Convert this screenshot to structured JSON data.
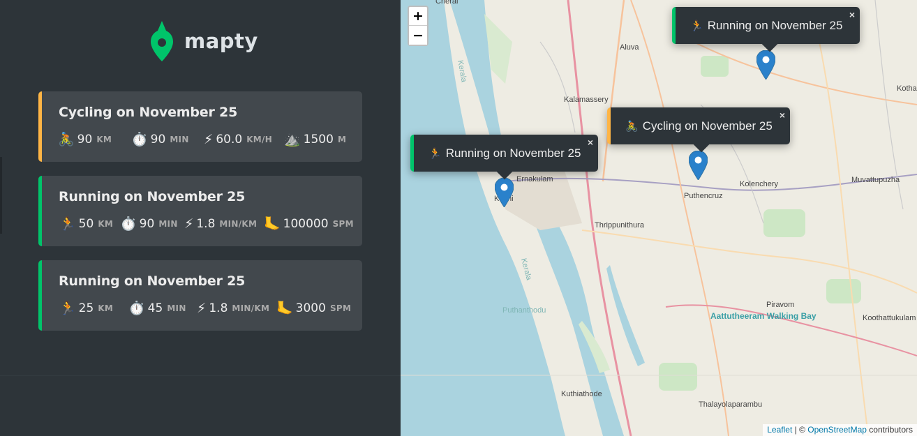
{
  "app": {
    "name": "mapty"
  },
  "workouts": [
    {
      "type": "cycling",
      "title": "Cycling on November 25",
      "icons": {
        "activity": "cycling-icon",
        "time": "stopwatch-icon",
        "speed": "lightning-icon",
        "elevation": "mountain-icon"
      },
      "distance": {
        "value": "90",
        "unit": "km"
      },
      "duration": {
        "value": "90",
        "unit": "min"
      },
      "speed": {
        "value": "60.0",
        "unit": "km/h"
      },
      "elevation": {
        "value": "1500",
        "unit": "m"
      }
    },
    {
      "type": "running",
      "title": "Running on November 25",
      "icons": {
        "activity": "running-icon",
        "time": "stopwatch-icon",
        "pace": "lightning-icon",
        "cadence": "foot-icon"
      },
      "distance": {
        "value": "50",
        "unit": "km"
      },
      "duration": {
        "value": "90",
        "unit": "min"
      },
      "pace": {
        "value": "1.8",
        "unit": "min/km"
      },
      "cadence": {
        "value": "100000",
        "unit": "spm"
      }
    },
    {
      "type": "running",
      "title": "Running on November 25",
      "icons": {
        "activity": "running-icon",
        "time": "stopwatch-icon",
        "pace": "lightning-icon",
        "cadence": "foot-icon"
      },
      "distance": {
        "value": "25",
        "unit": "km"
      },
      "duration": {
        "value": "45",
        "unit": "min"
      },
      "pace": {
        "value": "1.8",
        "unit": "min/km"
      },
      "cadence": {
        "value": "3000",
        "unit": "spm"
      }
    }
  ],
  "map": {
    "zoom": {
      "in": "+",
      "out": "−"
    },
    "popups": [
      {
        "type": "running",
        "label": "Running on November 25",
        "close": "×"
      },
      {
        "type": "cycling",
        "label": "Cycling on November 25",
        "close": "×"
      },
      {
        "type": "running",
        "label": "Running on November 25",
        "close": "×"
      }
    ],
    "places": {
      "cherai": "Cherai",
      "aluva": "Aluva",
      "kalamassery": "Kalamassery",
      "ernakulam": "Ernakulam",
      "kochi": "Kochi",
      "puthencruz": "Puthencruz",
      "kolenchery": "Kolenchery",
      "muvattupuzha": "Muvattupuzha",
      "thrippunithura": "Thrippunithura",
      "puthanthodu": "Puthanthodu",
      "piravom": "Piravom",
      "aattutheeram": "Aattutheeram Walking Bay",
      "koothattukulam": "Koothattukulam",
      "kuthiathode": "Kuthiathode",
      "thalayolaparambu": "Thalayolaparambu",
      "kothamangalam": "Kotha",
      "kerala1": "Kerala",
      "kerala2": "Kerala"
    },
    "attribution": {
      "leaflet": "Leaflet",
      "sep": " | © ",
      "osm": "OpenStreetMap",
      "contrib": " contributors"
    }
  },
  "colors": {
    "running": "#00c46a",
    "cycling": "#ffb545",
    "sidebar": "#2d3439",
    "card": "#42484d",
    "marker": "#2a81cb"
  }
}
